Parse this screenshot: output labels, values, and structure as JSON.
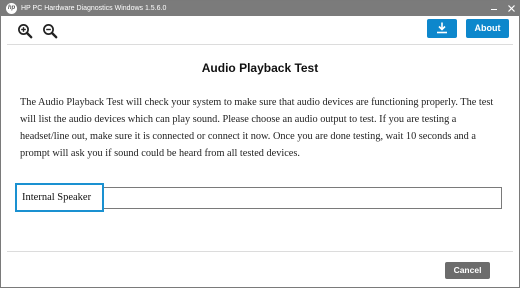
{
  "window": {
    "title": "HP PC Hardware Diagnostics Windows 1.5.6.0",
    "logo_text": "hp"
  },
  "toolbar": {
    "zoom_in_icon": "zoom-in-icon",
    "zoom_out_icon": "zoom-out-icon",
    "download_icon": "download-icon",
    "about_label": "About",
    "accent_color": "#0d87cc"
  },
  "main": {
    "title": "Audio Playback Test",
    "description": "The Audio Playback Test will check your system to make sure that audio devices are functioning properly. The test will list the audio devices which can play sound. Please choose an audio output to test. If you are testing a headset/line out, make sure it is connected or connect it now. Once you are done testing, wait 10 seconds and a prompt will ask you if sound could be heard from all tested devices.",
    "devices": [
      {
        "label": "Internal Speaker",
        "selected": true
      }
    ]
  },
  "footer": {
    "cancel_label": "Cancel"
  }
}
